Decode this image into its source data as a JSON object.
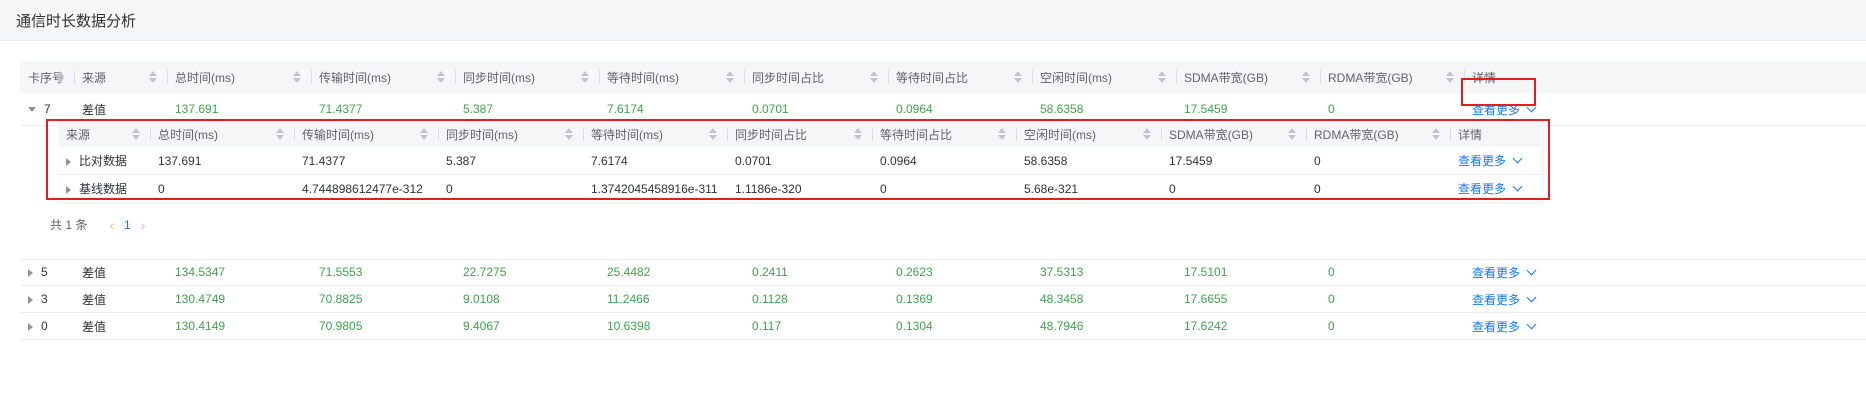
{
  "page": {
    "title": "通信时长数据分析"
  },
  "colors": {
    "accent": "#1677ff",
    "value_green": "#3ea34e",
    "highlight_red": "#e21e1e"
  },
  "outer_headers": [
    "卡序号",
    "来源",
    "总时间(ms)",
    "传输时间(ms)",
    "同步时间(ms)",
    "等待时间(ms)",
    "同步时间占比",
    "等待时间占比",
    "空闲时间(ms)",
    "SDMA带宽(GB)",
    "RDMA带宽(GB)",
    "详情"
  ],
  "expanded_row": {
    "card": "7",
    "source": "差值",
    "values": [
      "137.691",
      "71.4377",
      "5.387",
      "7.6174",
      "0.0701",
      "0.0964",
      "58.6358",
      "17.5459",
      "0"
    ],
    "more": "查看更多"
  },
  "inner_headers": [
    "来源",
    "总时间(ms)",
    "传输时间(ms)",
    "同步时间(ms)",
    "等待时间(ms)",
    "同步时间占比",
    "等待时间占比",
    "空闲时间(ms)",
    "SDMA带宽(GB)",
    "RDMA带宽(GB)",
    "详情"
  ],
  "inner_rows": [
    {
      "source": "比对数据",
      "values": [
        "137.691",
        "71.4377",
        "5.387",
        "7.6174",
        "0.0701",
        "0.0964",
        "58.6358",
        "17.5459",
        "0"
      ],
      "more": "查看更多"
    },
    {
      "source": "基线数据",
      "values": [
        "0",
        "4.744898612477e-312",
        "0",
        "1.3742045458916e-311",
        "1.1186e-320",
        "0",
        "5.68e-321",
        "0",
        "0"
      ],
      "more": "查看更多"
    }
  ],
  "pagination": {
    "total": "共 1 条",
    "current": "1",
    "prev": "‹",
    "next": "›"
  },
  "rows": [
    {
      "card": "5",
      "source": "差值",
      "values": [
        "134.5347",
        "71.5553",
        "22.7275",
        "25.4482",
        "0.2411",
        "0.2623",
        "37.5313",
        "17.5101",
        "0"
      ],
      "more": "查看更多"
    },
    {
      "card": "3",
      "source": "差值",
      "values": [
        "130.4749",
        "70.8825",
        "9.0108",
        "11.2466",
        "0.1128",
        "0.1369",
        "48.3458",
        "17.6655",
        "0"
      ],
      "more": "查看更多"
    },
    {
      "card": "0",
      "source": "差值",
      "values": [
        "130.4149",
        "70.9805",
        "9.4067",
        "10.6398",
        "0.117",
        "0.1304",
        "48.7946",
        "17.6242",
        "0"
      ],
      "more": "查看更多"
    }
  ]
}
